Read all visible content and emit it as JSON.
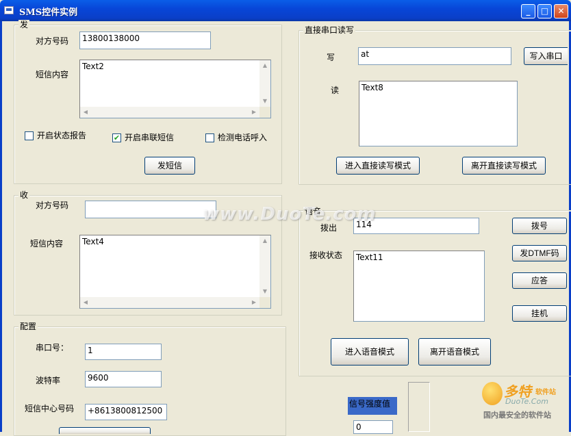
{
  "window": {
    "title": "SMS控件实例"
  },
  "send": {
    "group_caption": "发",
    "number_label": "对方号码",
    "number_value": "13800138000",
    "content_label": "短信内容",
    "content_value": "Text2",
    "report_label": "开启状态报告",
    "report_checked": false,
    "serial_sms_label": "开启串联短信",
    "serial_sms_checked": true,
    "detect_call_label": "检测电话呼入",
    "detect_call_checked": false,
    "send_button": "发短信"
  },
  "receive": {
    "group_caption": "收",
    "number_label": "对方号码",
    "number_value": "",
    "content_label": "短信内容",
    "content_value": "Text4"
  },
  "config": {
    "group_caption": "配置",
    "port_label": "串口号：",
    "port_value": "1",
    "baud_label": "波特率",
    "baud_value": "9600",
    "center_label": "短信中心号码",
    "center_value": "+8613800812500"
  },
  "serial": {
    "group_caption": "直接串口读写",
    "write_label": "写",
    "write_value": "at",
    "write_button": "写入串口",
    "read_label": "读",
    "read_value": "Text8",
    "enter_button": "进入直接读写模式",
    "leave_button": "离开直接读写模式"
  },
  "voice": {
    "group_caption": "语音",
    "dial_label": "拨出",
    "dial_value": "114",
    "status_label": "接收状态",
    "status_value": "Text11",
    "dial_button": "拨号",
    "dtmf_button": "发DTMF码",
    "answer_button": "应答",
    "hangup_button": "挂机",
    "enter_button": "进入语音模式",
    "leave_button": "离开语音模式"
  },
  "signal": {
    "label": "信号强度值",
    "value": "0"
  },
  "watermark": "www.DuoTe.com",
  "logo": {
    "brand": "多特",
    "brand_small": "软件站",
    "site": "DuoTe.Com",
    "slogan": "国内最安全的软件站"
  }
}
